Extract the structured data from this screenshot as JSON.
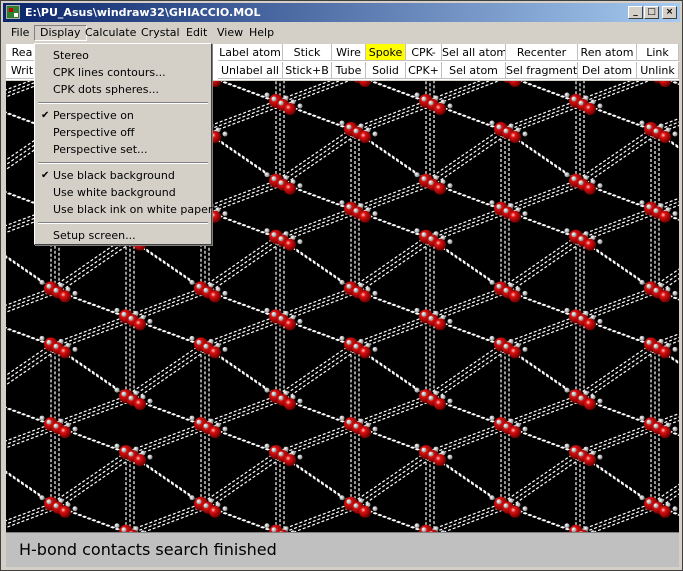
{
  "window": {
    "title": "E:\\PU_Asus\\windraw32\\GHIACCIO.MOL",
    "buttons": {
      "minimize": "_",
      "maximize": "□",
      "close": "×"
    }
  },
  "menubar": [
    "File",
    "Display",
    "Calculate",
    "Crystal",
    "Edit",
    "View",
    "Help"
  ],
  "toolbar": {
    "row1": [
      "Rea",
      "Label atom",
      "Stick",
      "Wire",
      "Spoke",
      "CPK-",
      "Sel all atom",
      "Recenter",
      "Ren atom",
      "Link"
    ],
    "row2": [
      "Writ",
      "Unlabel all",
      "Stick+B",
      "Tube",
      "Solid",
      "CPK+",
      "Sel atom",
      "Sel fragment",
      "Del atom",
      "Unlink"
    ],
    "highlighted": "Spoke",
    "highlight_color": "#ffff00",
    "indicator_color": "#f08020"
  },
  "display_menu": {
    "group1": [
      "Stereo",
      "CPK  lines contours...",
      "CPK dots spheres..."
    ],
    "group2": [
      {
        "label": "Perspective on",
        "checked": true
      },
      {
        "label": "Perspective off",
        "checked": false
      },
      {
        "label": "Perspective set...",
        "checked": false
      }
    ],
    "group3": [
      {
        "label": "Use black background",
        "checked": true
      },
      {
        "label": "Use white background",
        "checked": false
      },
      {
        "label": "Use black ink on white paper",
        "checked": false
      }
    ],
    "group4": [
      "Setup screen..."
    ]
  },
  "viewport": {
    "background": "#000000",
    "oxygen_color": "#e01010",
    "hydrogen_color": "#d0d0d0",
    "bond_color": "#ffffff"
  },
  "status": {
    "text": "H-bond contacts search finished"
  }
}
